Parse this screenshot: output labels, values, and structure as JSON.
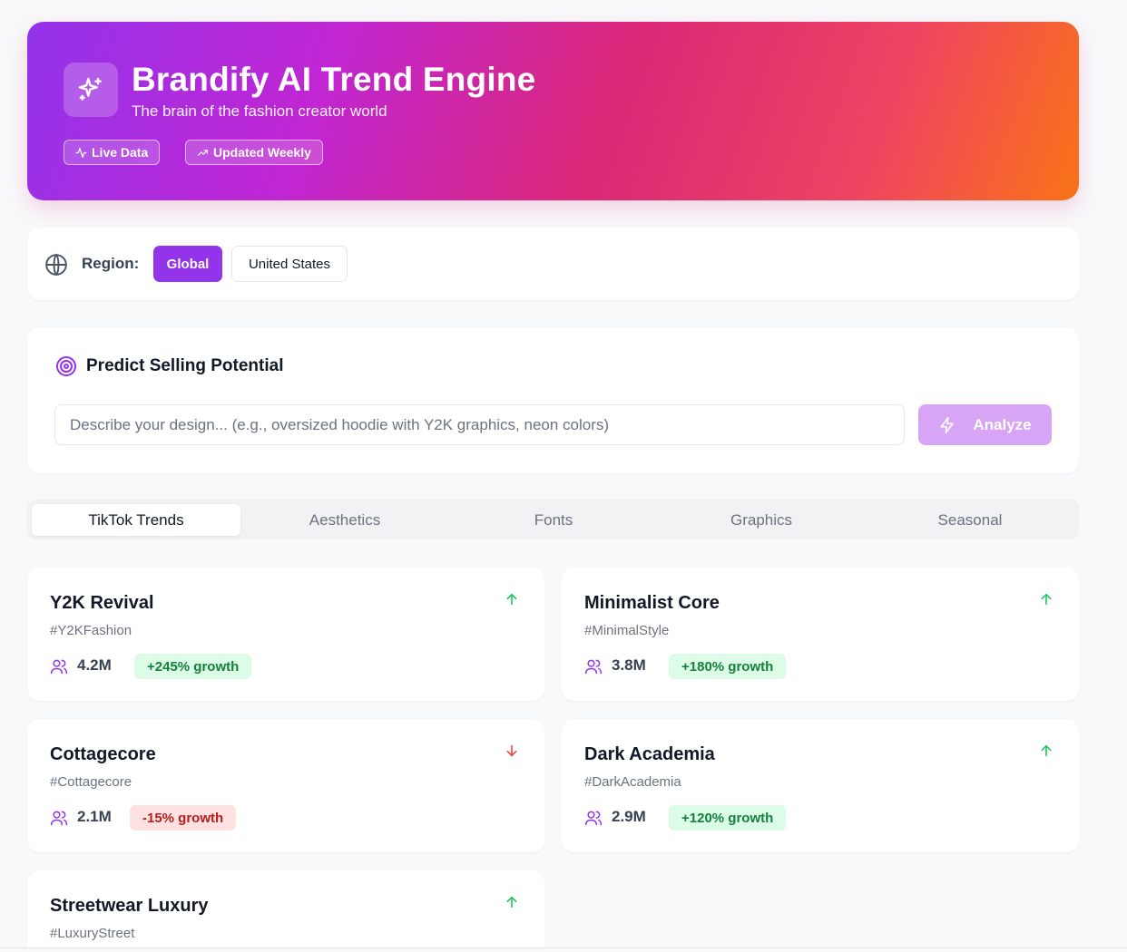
{
  "hero": {
    "title": "Brandify AI Trend Engine",
    "subtitle": "The brain of the fashion creator world",
    "badges": [
      {
        "label": "Live Data",
        "icon": "activity-icon"
      },
      {
        "label": "Updated Weekly",
        "icon": "trending-up-icon"
      }
    ]
  },
  "region": {
    "label": "Region:",
    "options": [
      {
        "label": "Global",
        "active": true
      },
      {
        "label": "United States",
        "active": false
      }
    ]
  },
  "predict": {
    "title": "Predict Selling Potential",
    "placeholder": "Describe your design... (e.g., oversized hoodie with Y2K graphics, neon colors)",
    "value": "",
    "analyze_label": "Analyze"
  },
  "tabs": [
    {
      "label": "TikTok Trends",
      "active": true
    },
    {
      "label": "Aesthetics",
      "active": false
    },
    {
      "label": "Fonts",
      "active": false
    },
    {
      "label": "Graphics",
      "active": false
    },
    {
      "label": "Seasonal",
      "active": false
    }
  ],
  "trends": [
    {
      "name": "Y2K Revival",
      "hashtag": "#Y2KFashion",
      "count": "4.2M",
      "growth": "+245% growth",
      "direction": "up"
    },
    {
      "name": "Minimalist Core",
      "hashtag": "#MinimalStyle",
      "count": "3.8M",
      "growth": "+180% growth",
      "direction": "up"
    },
    {
      "name": "Cottagecore",
      "hashtag": "#Cottagecore",
      "count": "2.1M",
      "growth": "-15% growth",
      "direction": "down"
    },
    {
      "name": "Dark Academia",
      "hashtag": "#DarkAcademia",
      "count": "2.9M",
      "growth": "+120% growth",
      "direction": "up"
    },
    {
      "name": "Streetwear Luxury",
      "hashtag": "#LuxuryStreet",
      "count": "",
      "growth": "",
      "direction": "up"
    }
  ],
  "colors": {
    "accent": "#9333ea",
    "up": "#22c55e",
    "down": "#ef4444",
    "gradient_start": "#9333ea",
    "gradient_mid": "#db2777",
    "gradient_end": "#f97316"
  }
}
